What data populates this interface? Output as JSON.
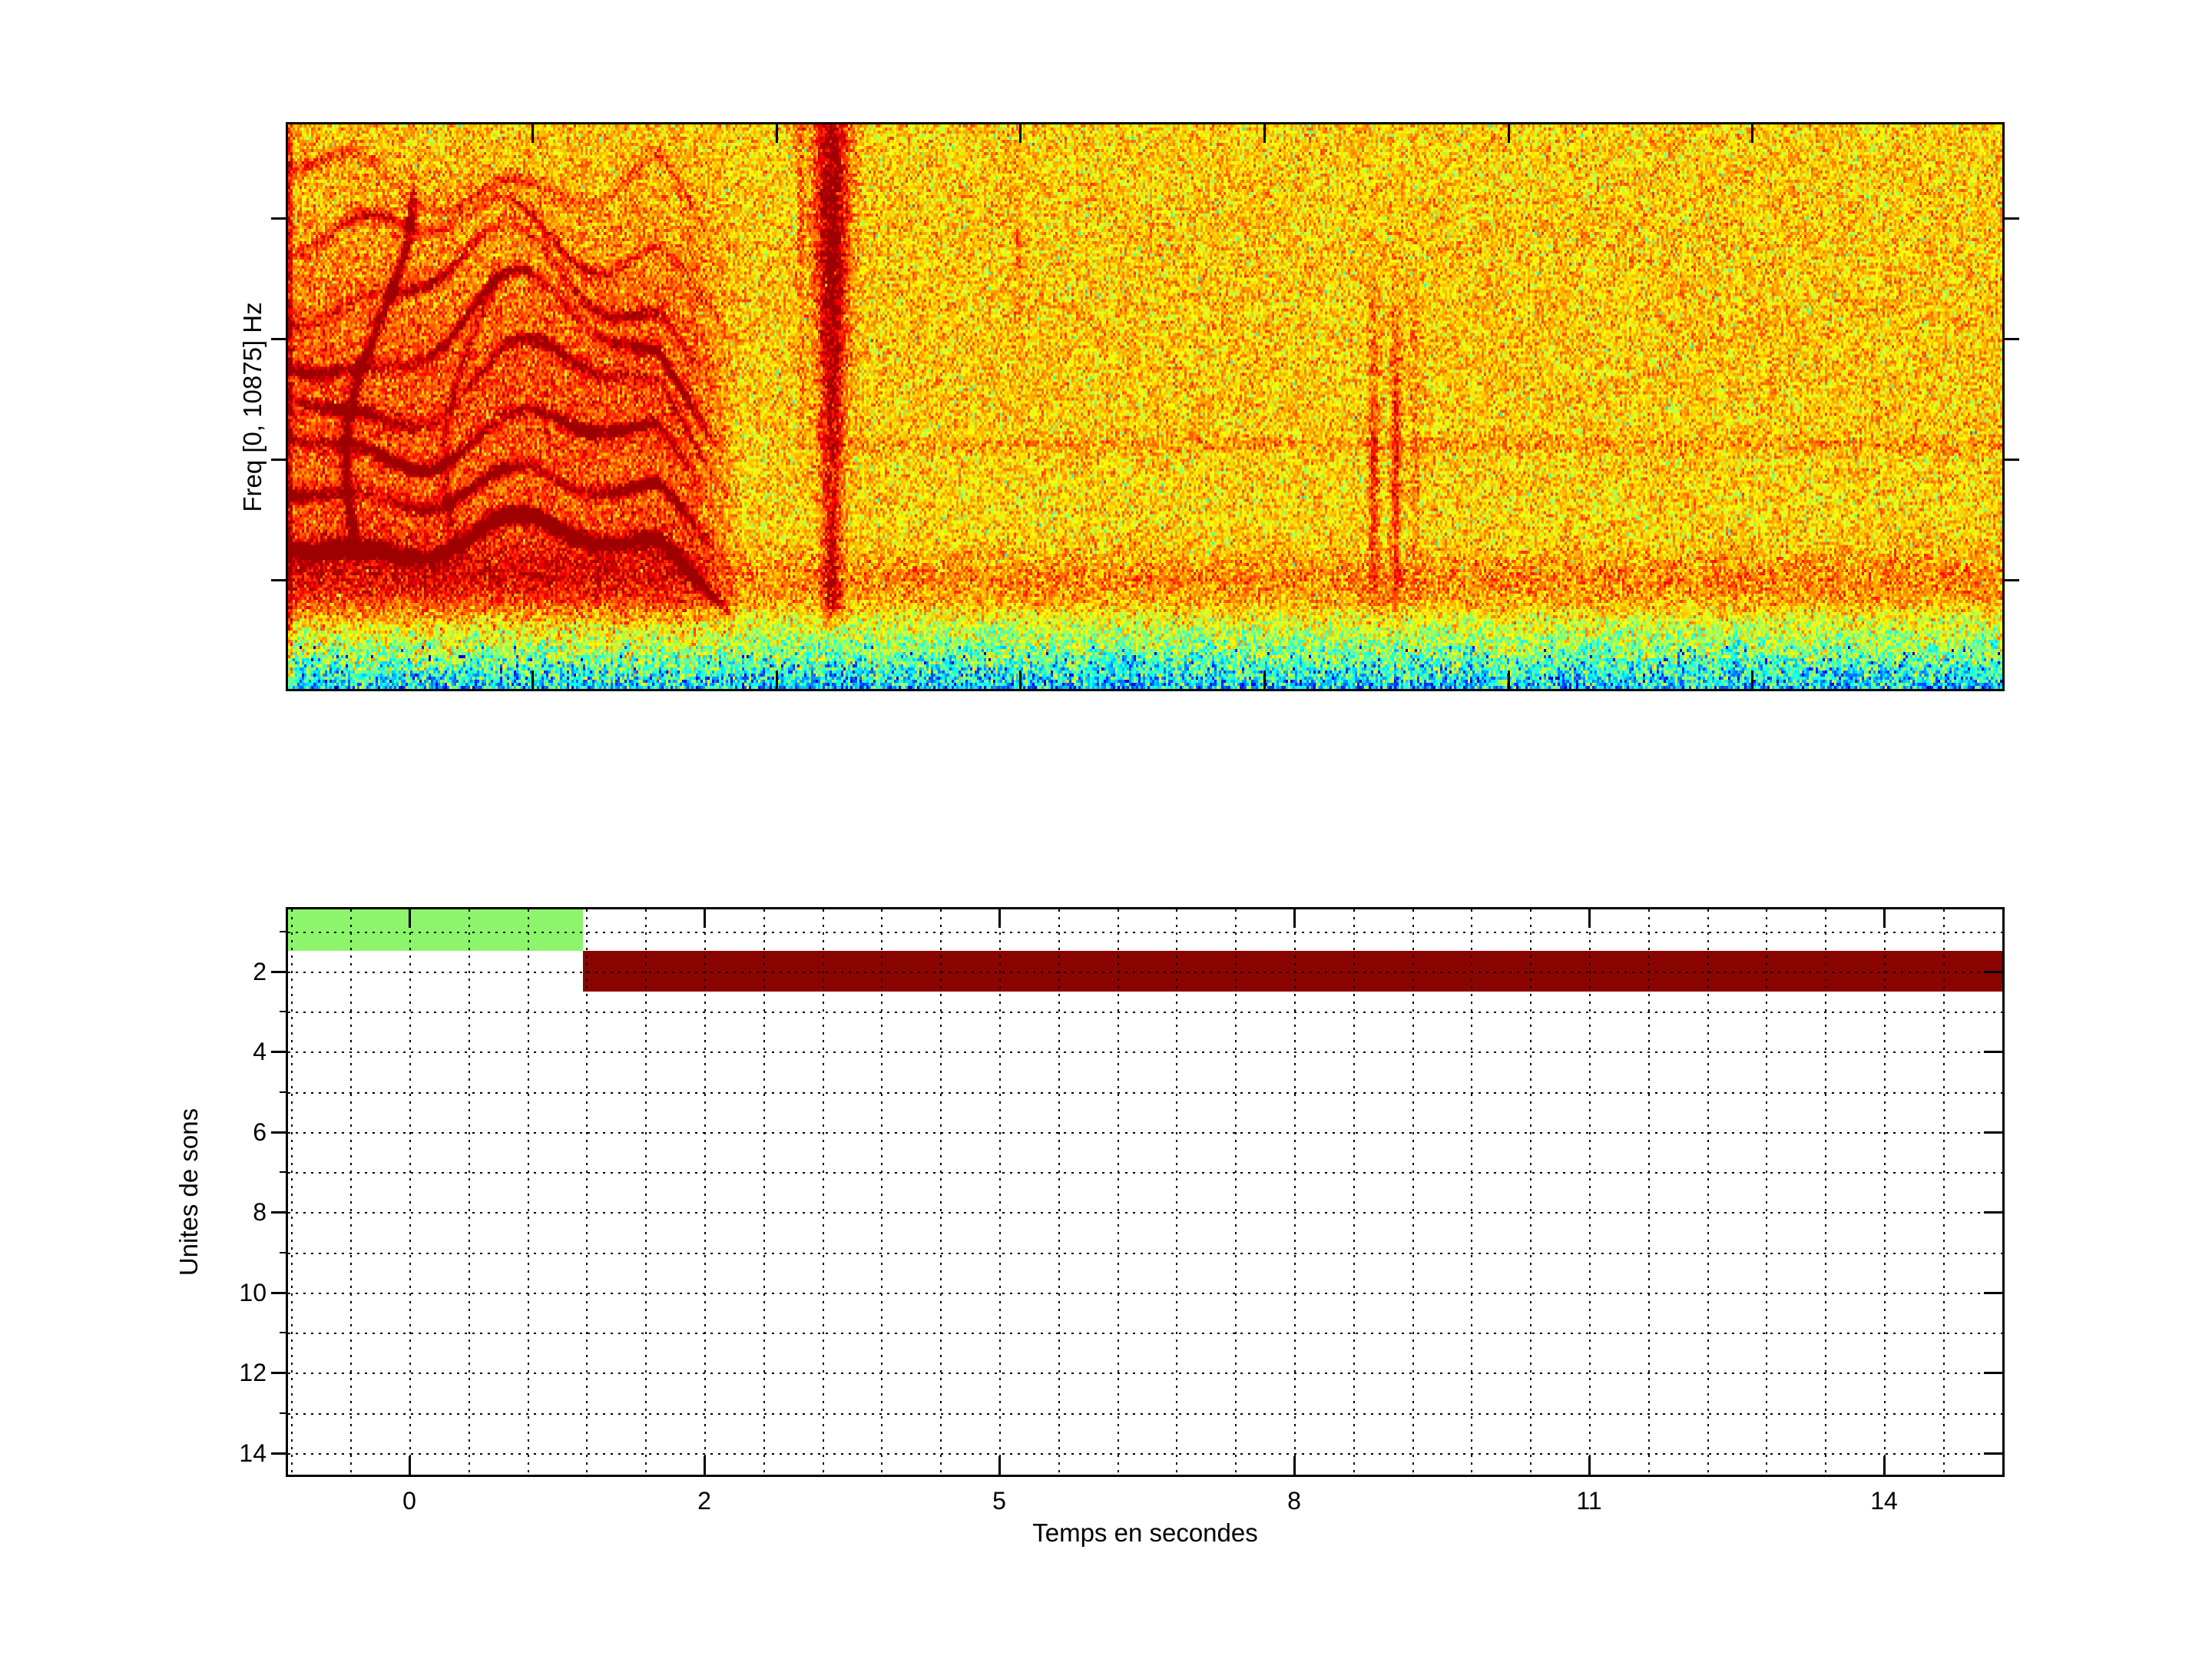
{
  "meta": {
    "description": "Two-panel analysis figure: speech spectrogram (top) and detected sound-unit segmentation timeline (bottom)"
  },
  "colors": {
    "background": "#ffffff",
    "axis": "#000000",
    "grid_dots": "#000000",
    "green_bar": "#8cf56c",
    "red_bar": "#8b0500"
  },
  "spectrogram": {
    "ylabel": "Freq [0, 10875] Hz"
  },
  "units_plot": {
    "ylabel": "Unites de sons",
    "xlabel": "Temps en secondes",
    "x_tick_labels": [
      "0",
      "2",
      "5",
      "8",
      "11",
      "14"
    ],
    "y_tick_labels": [
      "2",
      "4",
      "6",
      "8",
      "10",
      "12",
      "14"
    ]
  },
  "chart_data": [
    {
      "type": "heatmap",
      "id": "spectrogram",
      "ylabel": "Freq [0, 10875] Hz",
      "freq_range_hz": [
        0,
        10875
      ],
      "colormap": "jet",
      "features": [
        {
          "name": "voiced-harmonic-segment",
          "x_frac": [
            0.0,
            0.27
          ],
          "y_frac": [
            0.05,
            0.85
          ],
          "appearance": "red wavy harmonic tracks over orange noise, darkest fundamental near y_frac 0.72 with falling tail"
        },
        {
          "name": "onset-frequency-sweep",
          "x_frac": [
            0.03,
            0.07
          ],
          "y_frac": [
            0.08,
            0.78
          ]
        },
        {
          "name": "broadband-red-burst",
          "x_frac": [
            0.305,
            0.33
          ],
          "y_frac": [
            0.0,
            0.87
          ],
          "appearance": "narrow red vertical streak, wider at top"
        },
        {
          "name": "faint-streak",
          "x_frac": [
            0.295,
            0.302
          ],
          "y_frac": [
            0.0,
            0.6
          ]
        },
        {
          "name": "double-red-streak",
          "x_frac": [
            0.63,
            0.66
          ],
          "y_frac": [
            0.3,
            0.93
          ]
        },
        {
          "name": "noise-floor-band",
          "x_frac": [
            0.0,
            1.0
          ],
          "y_frac": [
            0.855,
            1.0
          ],
          "appearance": "yellow to green to cyan gradient with vertical stripes and blue specks at bottom"
        }
      ],
      "inner_x_tick_frac": [
        0.1425,
        0.2848,
        0.427,
        0.5693,
        0.7116,
        0.8538
      ],
      "outer_y_tick_frac": [
        0.166,
        0.38,
        0.593,
        0.807
      ]
    },
    {
      "type": "bar",
      "id": "units-timeline",
      "orientation": "horizontal-segments",
      "xlabel": "Temps en secondes",
      "ylabel": "Unites de sons",
      "x_tick_labels": [
        0,
        2,
        5,
        8,
        11,
        14
      ],
      "y_tick_labels": [
        2,
        4,
        6,
        8,
        10,
        12,
        14
      ],
      "ylim": [
        0.45,
        14.55
      ],
      "grid": "dotted major grid with dotted minor grid, drawn over bars",
      "segments": [
        {
          "unit": 1,
          "x_frac": [
            0.0,
            0.172
          ],
          "t_s_approx": [
            -1.2,
            1.7
          ],
          "value_span": [
            0.5,
            1.5
          ],
          "color_key": "green_bar"
        },
        {
          "unit": 2,
          "x_frac": [
            0.172,
            1.0
          ],
          "t_s_approx": [
            1.7,
            15.7
          ],
          "value_span": [
            1.5,
            2.5
          ],
          "color_key": "red_bar"
        }
      ]
    }
  ]
}
